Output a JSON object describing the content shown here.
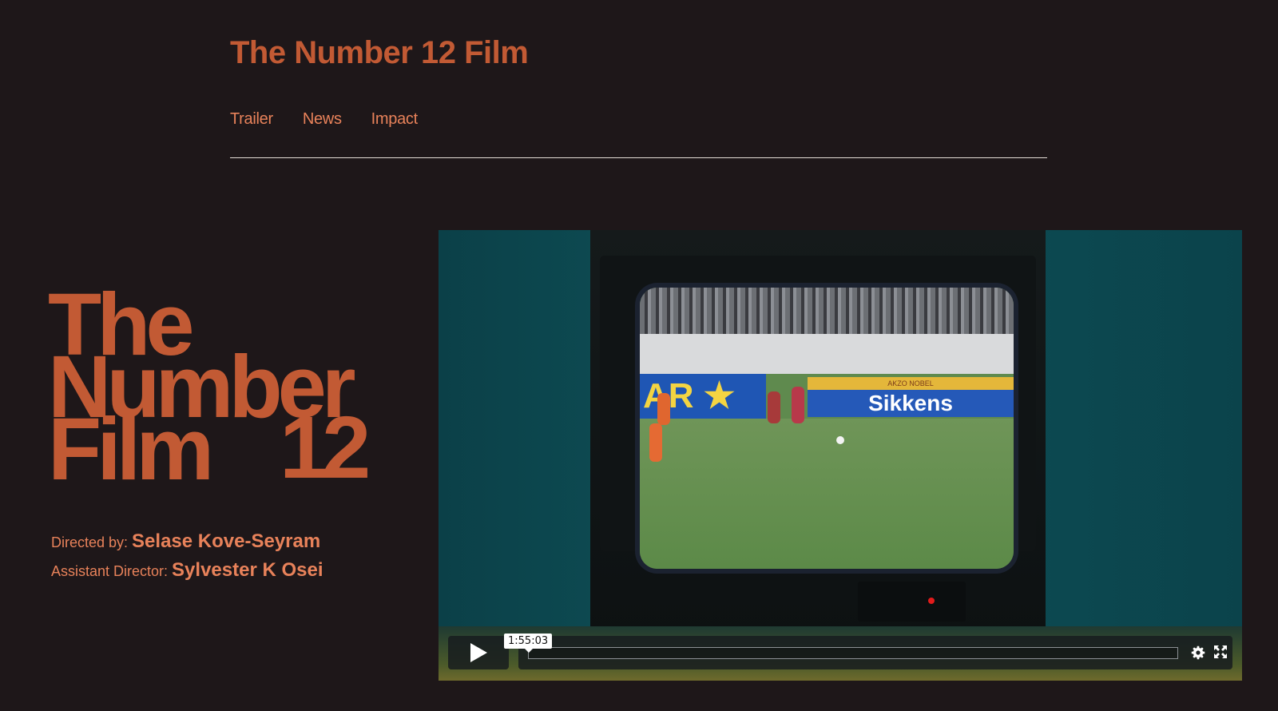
{
  "site": {
    "title": "The Number 12 Film"
  },
  "nav": {
    "items": [
      {
        "label": "Trailer"
      },
      {
        "label": "News"
      },
      {
        "label": "Impact"
      }
    ]
  },
  "hero": {
    "line1": "The",
    "line2": "Number",
    "line3": "Film",
    "line4": "12"
  },
  "credits": {
    "director_label": "Directed by:",
    "director_name": "Selase Kove-Seyram",
    "assistant_label": "Assistant Director:",
    "assistant_name": "Sylvester K Osei"
  },
  "video": {
    "duration_tooltip": "1:55:03",
    "progress": 0,
    "icons": {
      "play": "play-icon",
      "settings": "gear-icon",
      "fullscreen": "fullscreen-icon"
    },
    "frame": {
      "board_left_text": "AR ★",
      "board_right_text": "Sikkens",
      "board_right_small": "AKZO NOBEL"
    }
  },
  "colors": {
    "background": "#1e1719",
    "accent": "#c25a34",
    "link": "#e8825a"
  }
}
